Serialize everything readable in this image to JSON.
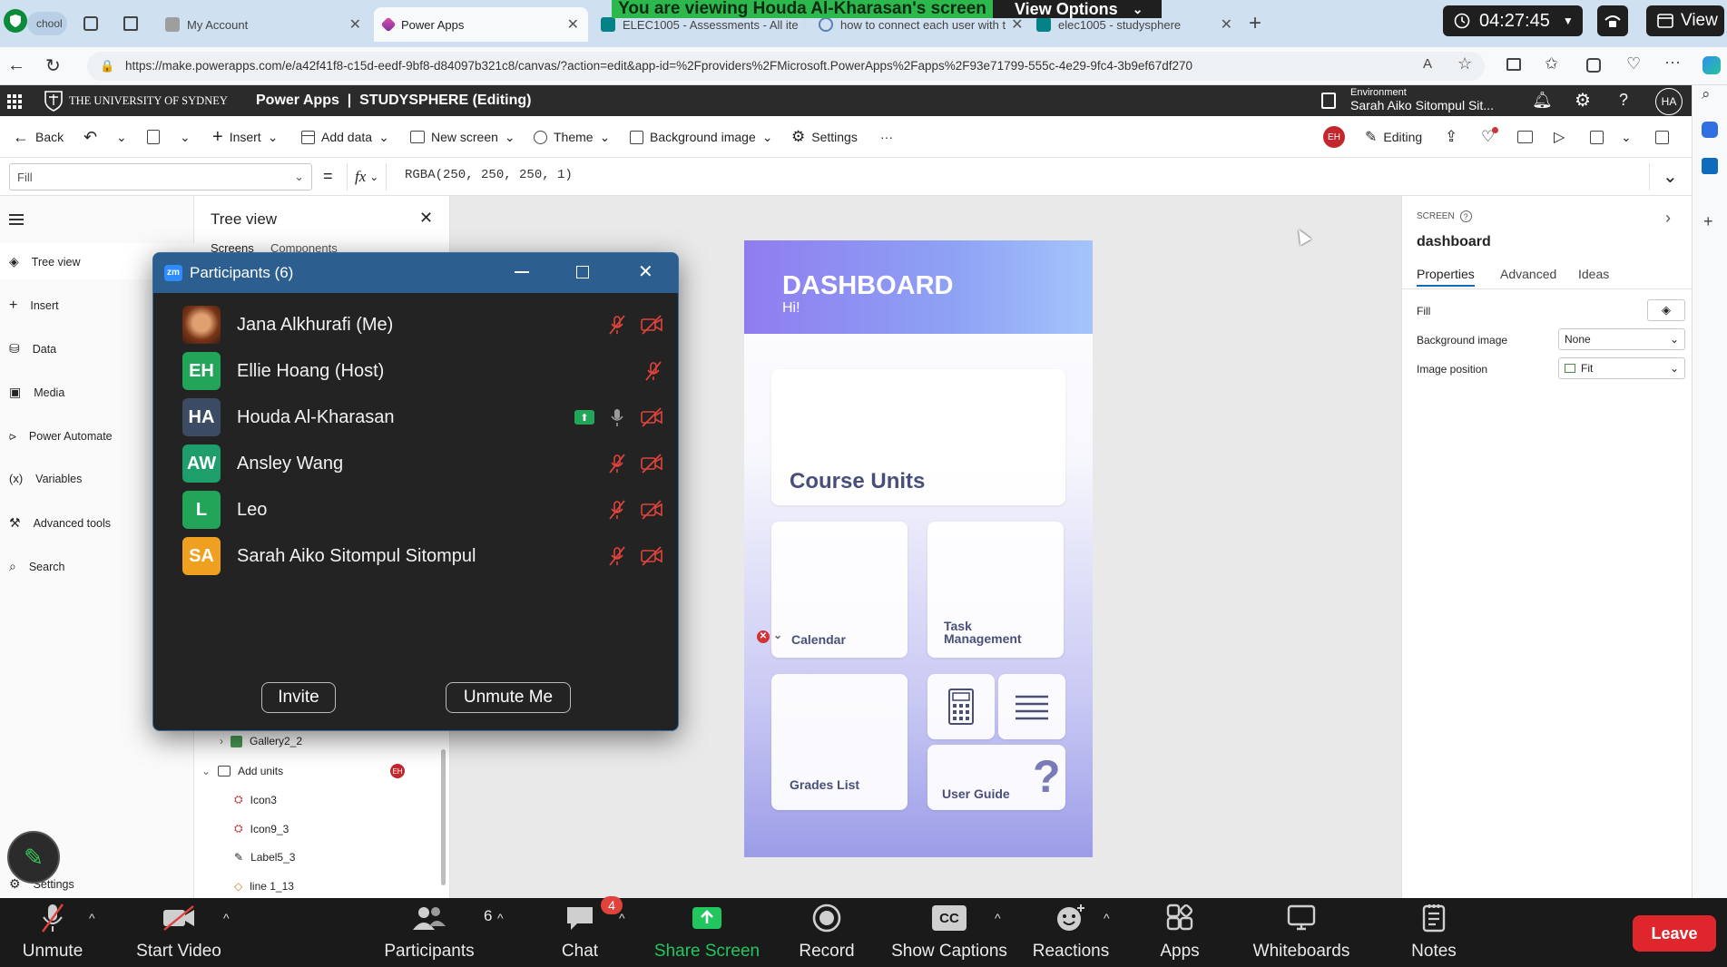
{
  "browser": {
    "tabs": [
      {
        "label": "chool",
        "favicon_color": "#2e7d32"
      },
      {
        "label": "My Account",
        "favicon_color": "#9e9e9e"
      },
      {
        "label": "Power Apps",
        "favicon_color": "#a03fa8"
      },
      {
        "label": "ELEC1005 - Assessments - All ite",
        "favicon_color": "#038387"
      },
      {
        "label": "how to connect each user with t",
        "favicon_color": "#5b7fb8"
      },
      {
        "label": "elec1005 - studysphere",
        "favicon_color": "#038387"
      }
    ],
    "url": "https://make.powerapps.com/e/a42f41f8-c15d-eedf-9bf8-d84097b321c8/canvas/?action=edit&app-id=%2Fproviders%2FMicrosoft.PowerApps%2Fapps%2F93e71799-555c-4e29-9fc4-3b9ef67df270"
  },
  "share": {
    "banner": "You are viewing Houda Al-Kharasan's screen",
    "view_options": "View Options",
    "timer": "04:27:45",
    "view": "View"
  },
  "powerapps": {
    "org": "THE UNIVERSITY OF SYDNEY",
    "title": "Power Apps  |  STUDYSPHERE (Editing)",
    "env_label": "Environment",
    "env_name": "Sarah Aiko Sitompul Sit...",
    "user_initials": "HA",
    "commands": {
      "back": "Back",
      "insert": "Insert",
      "add_data": "Add data",
      "new_screen": "New screen",
      "theme": "Theme",
      "background_image": "Background image",
      "settings": "Settings",
      "more": "···",
      "editor_initials": "EH",
      "editing": "Editing"
    },
    "formula": {
      "property": "Fill",
      "equals": "=",
      "fx": "fx",
      "expression": "RGBA(250, 250, 250, 1)"
    },
    "rail": [
      "Tree view",
      "Insert",
      "Data",
      "Media",
      "Power Automate",
      "Variables",
      "Advanced tools",
      "Search",
      "Settings"
    ],
    "tree": {
      "title": "Tree view",
      "tabs": [
        "Screens",
        "Components"
      ],
      "items": [
        {
          "label": "Gallery2_2"
        },
        {
          "label": "Add units",
          "badge": "EH"
        },
        {
          "label": "Icon3"
        },
        {
          "label": "Icon9_3"
        },
        {
          "label": "Label5_3"
        },
        {
          "label": "line 1_13"
        }
      ]
    },
    "app": {
      "header_title": "DASHBOARD",
      "header_sub": "Hi!",
      "course_units": "Course Units",
      "calendar": "Calendar",
      "task_management": "Task Management",
      "grades_list": "Grades List",
      "user_guide": "User Guide",
      "help_glyph": "?"
    },
    "properties": {
      "section": "SCREEN",
      "screen_name": "dashboard",
      "tabs": [
        "Properties",
        "Advanced",
        "Ideas"
      ],
      "fill_label": "Fill",
      "bg_image_label": "Background image",
      "bg_image_value": "None",
      "image_position_label": "Image position",
      "image_position_value": "Fit"
    }
  },
  "participants": {
    "title": "Participants (6)",
    "people": [
      {
        "name": "Jana Alkhurafi (Me)",
        "initials": "",
        "color": "#8a4b2e",
        "mic_muted": true,
        "video_off": true
      },
      {
        "name": "Ellie Hoang (Host)",
        "initials": "EH",
        "color": "#23a559",
        "mic_muted": true,
        "video_off": false
      },
      {
        "name": "Houda Al-Kharasan",
        "initials": "HA",
        "color": "#3b4b63",
        "mic_muted": false,
        "video_off": true,
        "sharing": true
      },
      {
        "name": "Ansley Wang",
        "initials": "AW",
        "color": "#1e9e6a",
        "mic_muted": true,
        "video_off": true
      },
      {
        "name": "Leo",
        "initials": "L",
        "color": "#23a559",
        "mic_muted": true,
        "video_off": true
      },
      {
        "name": "Sarah Aiko Sitompul Sitompul",
        "initials": "SA",
        "color": "#f0a020",
        "mic_muted": true,
        "video_off": true
      }
    ],
    "invite": "Invite",
    "unmute_me": "Unmute Me"
  },
  "zoom_toolbar": {
    "unmute": "Unmute",
    "start_video": "Start Video",
    "participants": "Participants",
    "participants_count": "6",
    "chat": "Chat",
    "chat_badge": "4",
    "share_screen": "Share Screen",
    "record": "Record",
    "show_captions": "Show Captions",
    "captions_glyph": "CC",
    "reactions": "Reactions",
    "apps": "Apps",
    "whiteboards": "Whiteboards",
    "notes": "Notes",
    "leave": "Leave"
  }
}
